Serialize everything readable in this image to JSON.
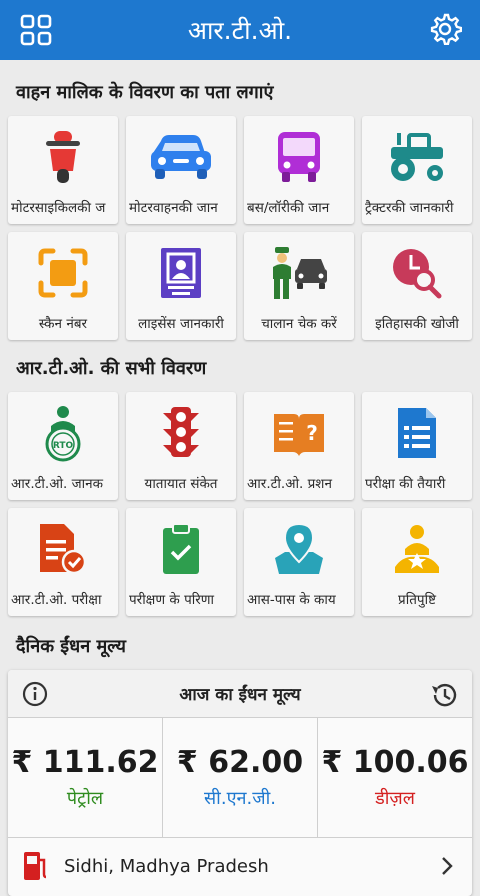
{
  "app": {
    "title": "आर.टी.ओ."
  },
  "sections": {
    "vehicle_owner": "वाहन मालिक के विवरण का पता लगाएं",
    "rto_details": "आर.टी.ओ. की सभी विवरण",
    "fuel": "दैनिक ईंधन मूल्य"
  },
  "vehicle_tiles": [
    {
      "label": "मोटरसाइकिलकी ज",
      "icon": "motorcycle-icon"
    },
    {
      "label": "मोटरवाहनकी जान",
      "icon": "car-icon"
    },
    {
      "label": "बस/लॉरीकी जान",
      "icon": "bus-icon"
    },
    {
      "label": "ट्रैक्टरकी जानकारी",
      "icon": "tractor-icon"
    },
    {
      "label": "स्कैन नंबर",
      "icon": "scan-icon"
    },
    {
      "label": "लाइसेंस जानकारी",
      "icon": "license-icon"
    },
    {
      "label": "चालान चेक करें",
      "icon": "challan-icon"
    },
    {
      "label": "इतिहासकी खोजी",
      "icon": "history-search-icon"
    }
  ],
  "rto_tiles": [
    {
      "label": "आर.टी.ओ. जानक",
      "icon": "rto-officer-icon"
    },
    {
      "label": "यातायात संकेत",
      "icon": "traffic-light-icon"
    },
    {
      "label": "आर.टी.ओ. प्रशन",
      "icon": "question-book-icon"
    },
    {
      "label": "परीक्षा की तैयारी",
      "icon": "exam-prep-icon"
    },
    {
      "label": "आर.टी.ओ. परीक्षा",
      "icon": "exam-document-icon"
    },
    {
      "label": "परीक्षण के परिणा",
      "icon": "clipboard-check-icon"
    },
    {
      "label": "आस-पास के काय",
      "icon": "map-pin-icon"
    },
    {
      "label": "प्रतिपुष्टि",
      "icon": "feedback-icon"
    }
  ],
  "fuel": {
    "title": "आज का ईंधन मूल्य",
    "prices": [
      {
        "value": "₹ 111.62",
        "name": "पेट्रोल",
        "color": "#2e8b1e"
      },
      {
        "value": "₹ 62.00",
        "name": "सी.एन.जी.",
        "color": "#1e78cf"
      },
      {
        "value": "₹ 100.06",
        "name": "डीज़ल",
        "color": "#d42020"
      }
    ],
    "location": "Sidhi, Madhya Pradesh"
  },
  "colors": {
    "appbar": "#1e78cf",
    "background": "#ebebeb"
  }
}
